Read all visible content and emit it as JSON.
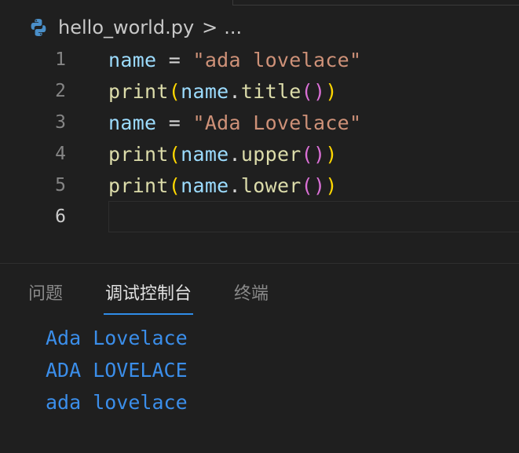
{
  "breadcrumb": {
    "file_name": "hello_world.py",
    "separator": ">",
    "more": "..."
  },
  "editor": {
    "lines": [
      {
        "number": "1",
        "tokens": [
          [
            "var",
            "name"
          ],
          [
            "op",
            " = "
          ],
          [
            "str",
            "\"ada lovelace\""
          ]
        ]
      },
      {
        "number": "2",
        "tokens": [
          [
            "fn",
            "print"
          ],
          [
            "paren1",
            "("
          ],
          [
            "var",
            "name"
          ],
          [
            "op",
            "."
          ],
          [
            "fn",
            "title"
          ],
          [
            "paren2",
            "()"
          ],
          [
            "paren1",
            ")"
          ]
        ]
      },
      {
        "number": "3",
        "tokens": [
          [
            "var",
            "name"
          ],
          [
            "op",
            " = "
          ],
          [
            "str",
            "\"Ada Lovelace\""
          ]
        ]
      },
      {
        "number": "4",
        "tokens": [
          [
            "fn",
            "print"
          ],
          [
            "paren1",
            "("
          ],
          [
            "var",
            "name"
          ],
          [
            "op",
            "."
          ],
          [
            "fn",
            "upper"
          ],
          [
            "paren2",
            "()"
          ],
          [
            "paren1",
            ")"
          ]
        ]
      },
      {
        "number": "5",
        "tokens": [
          [
            "fn",
            "print"
          ],
          [
            "paren1",
            "("
          ],
          [
            "var",
            "name"
          ],
          [
            "op",
            "."
          ],
          [
            "fn",
            "lower"
          ],
          [
            "paren2",
            "()"
          ],
          [
            "paren1",
            ")"
          ]
        ]
      },
      {
        "number": "6",
        "tokens": []
      }
    ],
    "current_line": "6"
  },
  "panel": {
    "tabs": [
      {
        "label": "问题",
        "active": false
      },
      {
        "label": "调试控制台",
        "active": true
      },
      {
        "label": "终端",
        "active": false
      }
    ],
    "output": [
      "Ada Lovelace",
      "ADA LOVELACE",
      "ada lovelace"
    ]
  },
  "colors": {
    "background": "#1f1f1f",
    "variable": "#9cdcfe",
    "string": "#ce9178",
    "function": "#dcdcaa",
    "bracket_level1": "#ffd700",
    "bracket_level2": "#da70d6",
    "output_text": "#3b8eea",
    "active_tab_underline": "#2f8ce8"
  }
}
